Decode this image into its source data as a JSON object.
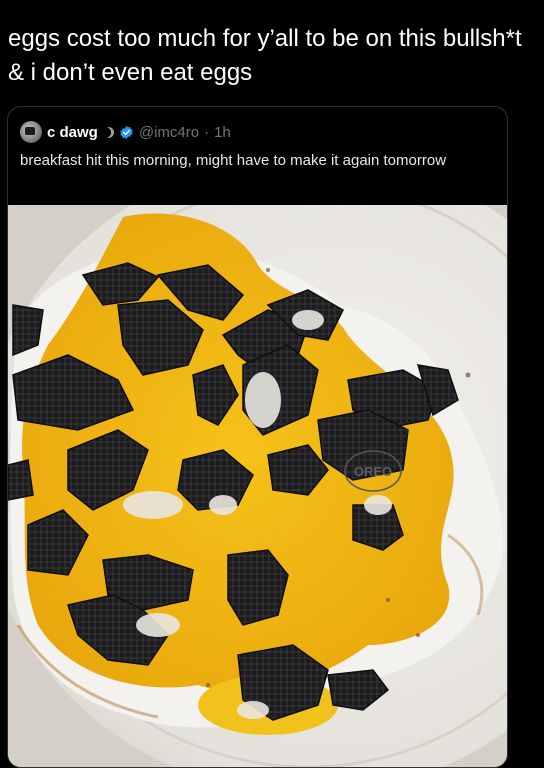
{
  "post": {
    "caption": "eggs cost too much for y’all to be on this bullsh*t\n& i don’t even eat eggs"
  },
  "quoted_post": {
    "display_name": "c dawg",
    "handle": "@imc4ro",
    "separator": "·",
    "time": "1h",
    "text": "breakfast hit this morning, might have to make it again tomorrow",
    "photo": {
      "stamp_text": "OREO"
    }
  },
  "icons": {
    "avatar": "avatar-image",
    "moon": "moon-icon",
    "verified": "verified-badge-icon"
  },
  "colors": {
    "background": "#000000",
    "text": "#e7e9ea",
    "muted": "#71767b",
    "verified_blue": "#1d9bf0",
    "card_border": "#2f3336"
  }
}
